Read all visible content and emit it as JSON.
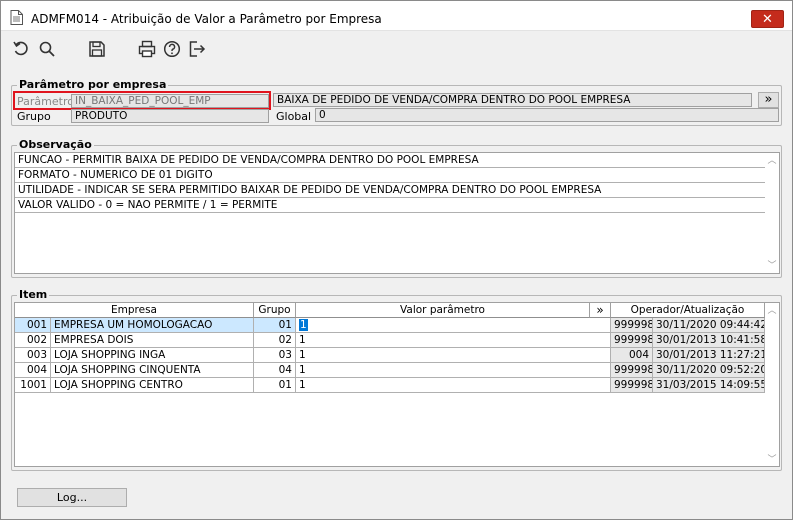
{
  "window": {
    "title": "ADMFM014 - Atribuição de Valor a Parâmetro por Empresa",
    "close_glyph": "✕"
  },
  "toolbar": {
    "icons": [
      "undo-icon",
      "search-icon",
      "save-icon",
      "print-icon",
      "help-icon",
      "exit-icon"
    ]
  },
  "parametro": {
    "group_label": "Parâmetro por empresa",
    "parametro_label": "Parâmetro",
    "parametro_value": "IN_BAIXA_PED_POOL_EMP",
    "parametro_desc": "BAIXA DE PEDIDO DE VENDA/COMPRA DENTRO DO POOL EMPRESA",
    "more_button": "»",
    "grupo_label": "Grupo",
    "grupo_value": "PRODUTO",
    "global_label": "Global",
    "global_value": "0"
  },
  "observacao": {
    "group_label": "Observação",
    "lines": [
      "FUNCAO - PERMITIR BAIXA DE PEDIDO DE VENDA/COMPRA DENTRO DO POOL EMPRESA",
      "FORMATO - NUMERICO DE 01 DIGITO",
      "UTILIDADE - INDICAR SE SERA PERMITIDO BAIXAR DE PEDIDO DE VENDA/COMPRA DENTRO DO POOL EMPRESA",
      "VALOR VALIDO - 0 = NAO PERMITE / 1 = PERMITE"
    ]
  },
  "item": {
    "group_label": "Item",
    "headers": {
      "empresa": "Empresa",
      "grupo": "Grupo",
      "valor": "Valor parâmetro",
      "more": "»",
      "operador": "Operador/Atualização"
    },
    "rows": [
      {
        "code": "001",
        "empresa": "EMPRESA UM HOMOLOGACAO",
        "grupo": "01",
        "valor": "1",
        "operador": "999998",
        "data": "30/11/2020 09:44:42"
      },
      {
        "code": "002",
        "empresa": "EMPRESA DOIS",
        "grupo": "02",
        "valor": "1",
        "operador": "999998",
        "data": "30/01/2013 10:41:58"
      },
      {
        "code": "003",
        "empresa": "LOJA SHOPPING INGA",
        "grupo": "03",
        "valor": "1",
        "operador": "004",
        "data": "30/01/2013 11:27:21"
      },
      {
        "code": "004",
        "empresa": "LOJA SHOPPING CINQUENTA",
        "grupo": "04",
        "valor": "1",
        "operador": "999998",
        "data": "30/11/2020 09:52:20"
      },
      {
        "code": "1001",
        "empresa": "LOJA SHOPPING  CENTRO",
        "grupo": "01",
        "valor": "1",
        "operador": "999998",
        "data": "31/03/2015 14:09:55"
      }
    ]
  },
  "footer": {
    "log_button": "Log..."
  },
  "colors": {
    "highlight_border": "#e0141e",
    "selection": "#cce8ff",
    "close_button": "#c42b1c"
  }
}
